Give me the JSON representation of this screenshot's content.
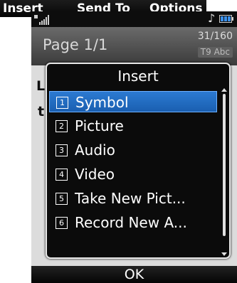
{
  "menu_bar": {
    "insert": "Insert",
    "send_to": "Send To",
    "options": "Options"
  },
  "status": {
    "signal_icon": "signal-bars-icon",
    "music_icon": "music-note-icon",
    "music_glyph": "♪",
    "battery_icon": "battery-icon"
  },
  "header": {
    "title": "Page 1/1",
    "char_count": "31/160",
    "input_mode": "T9 Abc"
  },
  "editor": {
    "line1": "L",
    "line2": "t"
  },
  "popup": {
    "title": "Insert",
    "items": [
      {
        "num": "1",
        "label": "Symbol"
      },
      {
        "num": "2",
        "label": "Picture"
      },
      {
        "num": "3",
        "label": "Audio"
      },
      {
        "num": "4",
        "label": "Video"
      },
      {
        "num": "5",
        "label": "Take New Pict..."
      },
      {
        "num": "6",
        "label": "Record New A..."
      }
    ],
    "selected_index": 0
  },
  "softkey": {
    "ok": "OK"
  },
  "colors": {
    "selection": "#1a5fb0",
    "popup_bg": "#0b0b0b",
    "header_bg": "#5a5a5a"
  }
}
